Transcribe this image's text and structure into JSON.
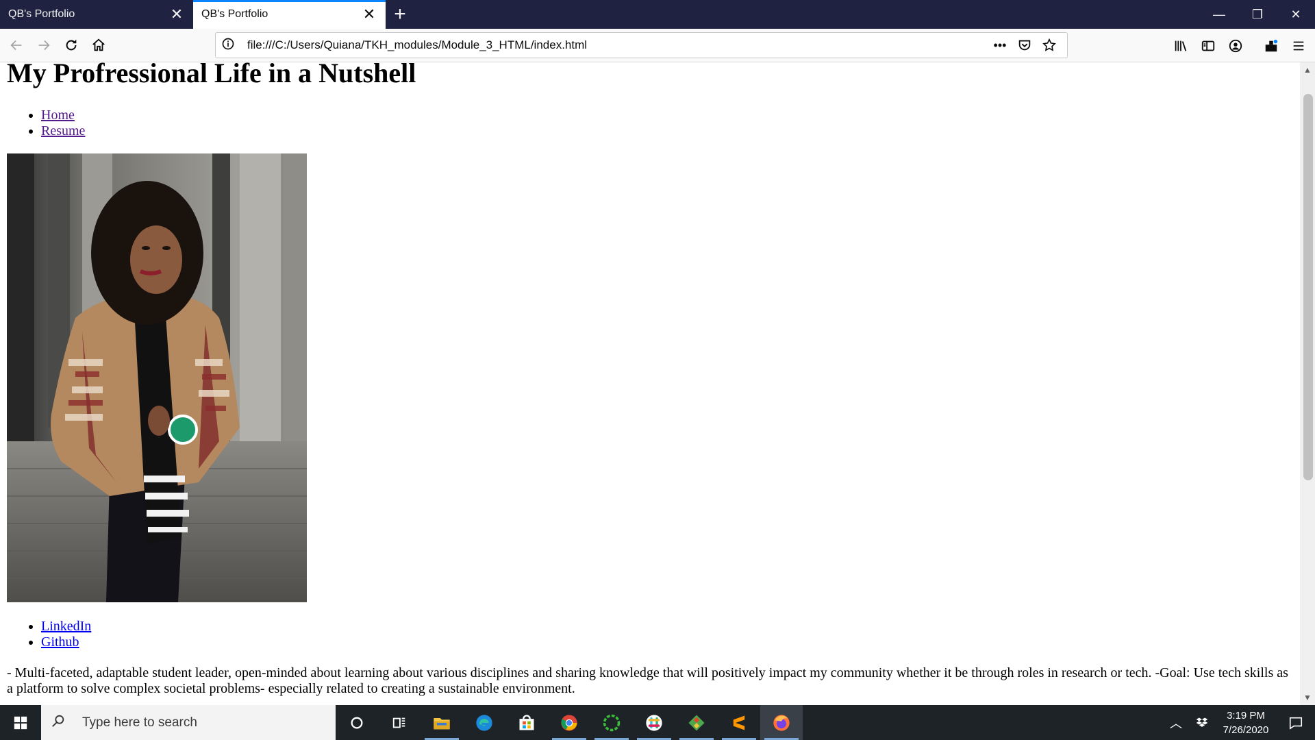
{
  "browser": {
    "tabs": [
      {
        "title": "QB's Portfolio",
        "active": false
      },
      {
        "title": "QB's Portfolio",
        "active": true
      }
    ],
    "url": "file:///C:/Users/Quiana/TKH_modules/Module_3_HTML/index.html",
    "accent_color": "#0a84ff",
    "tabbar_color": "#1f2341"
  },
  "page": {
    "heading": "My Profressional Life in a Nutshell",
    "nav_links": [
      "Home",
      "Resume"
    ],
    "social_links": [
      "LinkedIn",
      "Github"
    ],
    "bio": "- Multi-faceted, adaptable student leader, open-minded about learning about various disciplines and sharing knowledge that will positively impact my community whether it be through roles in research or tech. -Goal: Use tech skills as a platform to solve complex societal problems- especially related to creating a sustainable environment."
  },
  "taskbar": {
    "search_placeholder": "Type here to search",
    "apps": [
      "cortana-icon",
      "task-view-icon",
      "file-explorer-icon",
      "edge-icon",
      "store-icon",
      "chrome-icon",
      "app-green-ring-icon",
      "slack-icon",
      "git-icon",
      "sublime-icon",
      "firefox-icon"
    ],
    "time": "3:19 PM",
    "date": "7/26/2020"
  }
}
